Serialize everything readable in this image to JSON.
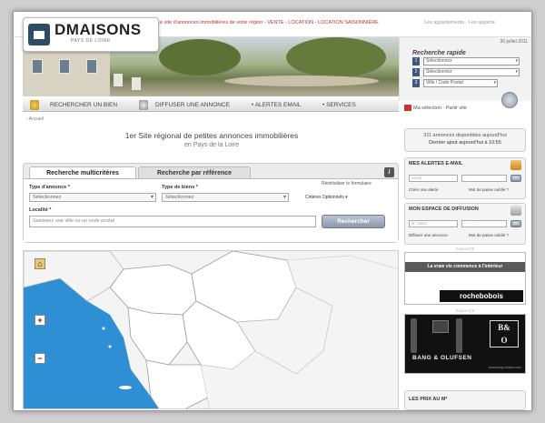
{
  "header": {
    "logo_title": "DMAISONS",
    "logo_sub": "PAYS DE LOIRE",
    "tagline": "Le site d'annonces immobilières de votre région - VENTE - LOCATION - LOCATION SAISONNIÈRE",
    "tagline_right": "Les appartements · Les apparte"
  },
  "quick_search": {
    "date": "30 juillet 2011",
    "title": "Recherche rapide",
    "rows": [
      {
        "num": "1",
        "value": "Sélectionnez"
      },
      {
        "num": "2",
        "value": "Sélectionnez"
      },
      {
        "num": "3",
        "value": "Ville / Code Postal"
      }
    ]
  },
  "nav": {
    "search": "RECHERCHER UN BIEN",
    "publish": "DIFFUSER UNE ANNONCE",
    "alerts": "• ALERTES EMAIL",
    "services": "• SERVICES"
  },
  "selection": "Ma sélection · Partir vite",
  "breadcrumb": "› Accueil",
  "headline": "1er Site régional de petites annonces immobilières",
  "headline_sub": "en Pays de la Loire",
  "search": {
    "tab_multi": "Recherche multicritères",
    "tab_ref": "Recherche par référence",
    "info": "i",
    "reset": "Réinitialiser le formulaire",
    "type_annonce_label": "Type d'annonce *",
    "type_annonce_value": "Sélectionnez",
    "type_bien_label": "Type de biens *",
    "type_bien_value": "Sélectionnez",
    "criteres": "Critères Optionnels ▾",
    "localite_label": "Localité *",
    "localite_placeholder": "Saisissez une ville ou un code postal",
    "submit": "Rechercher"
  },
  "map": {
    "zoom_in": "+",
    "zoom_out": "−"
  },
  "sidebar": {
    "count_text": "311 annonces disponibles aujourd'hui",
    "count_sub": "Dernier ajout aujourd'hui à 10:55",
    "alerts": {
      "title": "MES ALERTES E-MAIL",
      "email_placeholder": "email",
      "password_placeholder": "········",
      "ok": "OK",
      "create": "Créer une alerte",
      "forgot": "Mot de passe oublié ?"
    },
    "space": {
      "title": "MON ESPACE DE DIFFUSION",
      "login_placeholder": "N° client",
      "password_placeholder": "········",
      "ok": "OK",
      "diffuse": "Diffuser une annonce",
      "forgot": "Mot de passe oublié ?"
    },
    "ad_sep": "PUBLICITÉ",
    "roche_band": "La vraie vie commence à l'intérieur",
    "roche_logo": "rochebobois",
    "bo_logo_top": "B&",
    "bo_logo_bottom": "O",
    "bo_text": "BANG & OLUFSEN",
    "bo_footer": "www.bang-olufsen.com",
    "prix_title": "LES PRIX AU M²"
  }
}
